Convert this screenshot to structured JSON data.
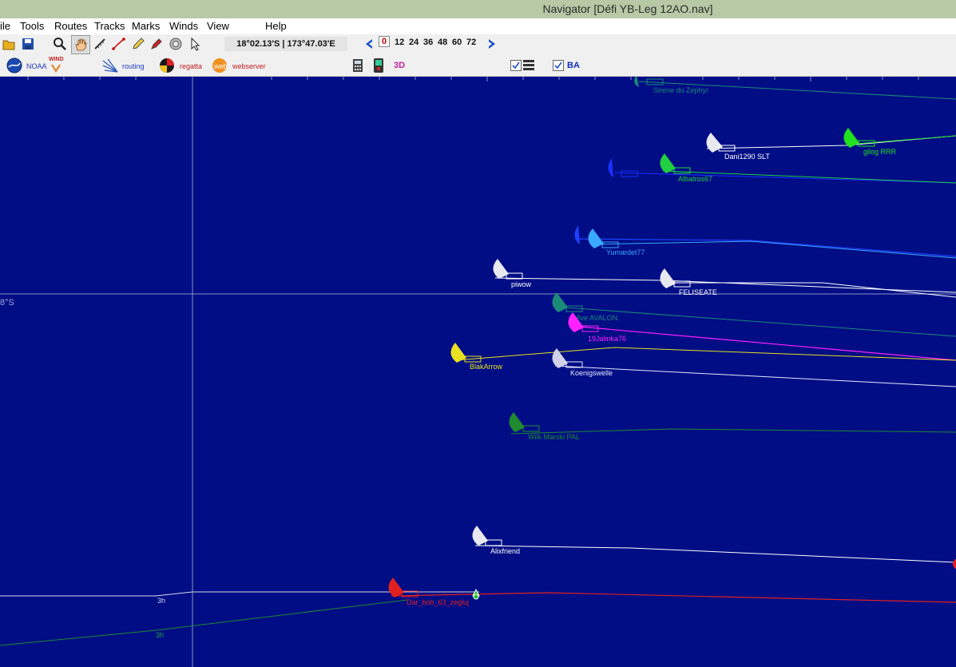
{
  "window": {
    "title": "Navigator [Défi YB-Leg 12AO.nav]"
  },
  "menu": {
    "items": [
      "ile",
      "Tools",
      "Routes",
      "Tracks",
      "Marks",
      "Winds",
      "View",
      "Help"
    ]
  },
  "toolbar": {
    "coordinates": "18°02.13'S | 173°47.03'E",
    "hours": [
      "0",
      "12",
      "24",
      "36",
      "48",
      "60",
      "72"
    ],
    "selected_hour": "0"
  },
  "toolbar2": {
    "noaa": "NOAA",
    "wind": "WIND",
    "routing": "routing",
    "regatta": "regatta",
    "webserver": "webserver",
    "threed": "3D",
    "ba": "BA"
  },
  "map": {
    "latitude_label": "8°S",
    "track_hour_label": "3h",
    "boats": [
      {
        "name": "Sirène du Zephyr",
        "color": "#1c8a78"
      },
      {
        "name": "Dani1290 SLT",
        "color": "#ffffff"
      },
      {
        "name": "gllog RRR",
        "color": "#20e020"
      },
      {
        "name": "Albatros67",
        "color": "#20d040"
      },
      {
        "name": "Yumardet77",
        "color": "#3aa8ff"
      },
      {
        "name": "piwow",
        "color": "#ffffff"
      },
      {
        "name": "FELISEATE",
        "color": "#ffffff"
      },
      {
        "name": "Rêve AVALON",
        "color": "#1c8a78"
      },
      {
        "name": "19Jalinka76",
        "color": "#ff20ff"
      },
      {
        "name": "BlakArrow",
        "color": "#e8e020"
      },
      {
        "name": "Koenigswelle",
        "color": "#e8e8ff"
      },
      {
        "name": "Wilk Marski PAL",
        "color": "#208a30"
      },
      {
        "name": "Alixfriend",
        "color": "#ffffff"
      },
      {
        "name": "Dar_bob_63_zegluj",
        "color": "#e02020"
      }
    ]
  }
}
